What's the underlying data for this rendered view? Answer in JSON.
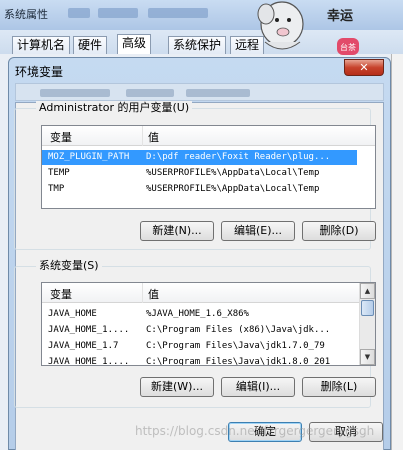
{
  "system_properties": {
    "title": "系统属性",
    "tabs": [
      "计算机名",
      "硬件",
      "高级",
      "系统保护",
      "远程"
    ],
    "selected_tab": "高级"
  },
  "mascot": {
    "text": "幸运",
    "stamp": "台茶"
  },
  "dialog": {
    "title": "环境变量",
    "close": "✕"
  },
  "user_vars": {
    "label": "Administrator 的用户变量(U)",
    "columns": [
      "变量",
      "值"
    ],
    "rows": [
      {
        "name": "MOZ_PLUGIN_PATH",
        "value": "D:\\pdf reader\\Foxit Reader\\plug...",
        "selected": true
      },
      {
        "name": "TEMP",
        "value": "%USERPROFILE%\\AppData\\Local\\Temp"
      },
      {
        "name": "TMP",
        "value": "%USERPROFILE%\\AppData\\Local\\Temp"
      }
    ],
    "buttons": {
      "new": "新建(N)...",
      "edit": "编辑(E)...",
      "delete": "删除(D)"
    }
  },
  "system_vars": {
    "label": "系统变量(S)",
    "columns": [
      "变量",
      "值"
    ],
    "rows": [
      {
        "name": "JAVA_HOME",
        "value": "%JAVA_HOME_1.6_X86%"
      },
      {
        "name": "JAVA_HOME_1....",
        "value": "C:\\Program Files (x86)\\Java\\jdk..."
      },
      {
        "name": "JAVA_HOME_1.7",
        "value": "C:\\Program Files\\Java\\jdk1.7.0_79"
      },
      {
        "name": "JAVA_HOME_1....",
        "value": "C:\\Program Files\\Java\\jdk1.8.0_201"
      }
    ],
    "buttons": {
      "new": "新建(W)...",
      "edit": "编辑(I)...",
      "delete": "删除(L)"
    }
  },
  "footer": {
    "ok": "确定",
    "cancel": "取消"
  },
  "watermark": "https://blog.csdn.net/fzrgergergerygsgh"
}
